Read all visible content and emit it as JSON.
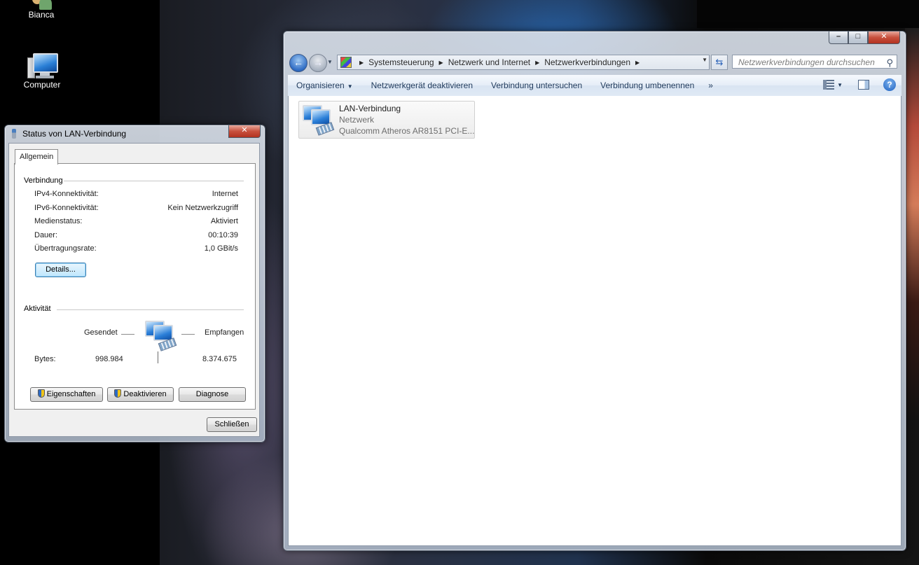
{
  "desktop": {
    "icons": [
      {
        "label": "Bianca"
      },
      {
        "label": "Computer"
      }
    ]
  },
  "explorer": {
    "address": {
      "crumbs": [
        "Systemsteuerung",
        "Netzwerk und Internet",
        "Netzwerkverbindungen"
      ]
    },
    "search_placeholder": "Netzwerkverbindungen durchsuchen",
    "toolbar": {
      "organize": "Organisieren",
      "disable": "Netzwerkgerät deaktivieren",
      "diagnose": "Verbindung untersuchen",
      "rename": "Verbindung umbenennen",
      "more": "»"
    },
    "connections": [
      {
        "name": "LAN-Verbindung",
        "network": "Netzwerk",
        "device": "Qualcomm Atheros AR8151 PCI-E..."
      }
    ]
  },
  "dialog": {
    "title": "Status von LAN-Verbindung",
    "tab": "Allgemein",
    "connection": {
      "heading": "Verbindung",
      "rows": [
        {
          "label": "IPv4-Konnektivität:",
          "value": "Internet"
        },
        {
          "label": "IPv6-Konnektivität:",
          "value": "Kein Netzwerkzugriff"
        },
        {
          "label": "Medienstatus:",
          "value": "Aktiviert"
        },
        {
          "label": "Dauer:",
          "value": "00:10:39"
        },
        {
          "label": "Übertragungsrate:",
          "value": "1,0 GBit/s"
        }
      ],
      "details_button": "Details..."
    },
    "activity": {
      "heading": "Aktivität",
      "sent_label": "Gesendet",
      "received_label": "Empfangen",
      "bytes_label": "Bytes:",
      "bytes_sent": "998.984",
      "bytes_received": "8.374.675"
    },
    "buttons": {
      "properties": "Eigenschaften",
      "deactivate": "Deaktivieren",
      "diagnose": "Diagnose",
      "close": "Schließen"
    }
  }
}
